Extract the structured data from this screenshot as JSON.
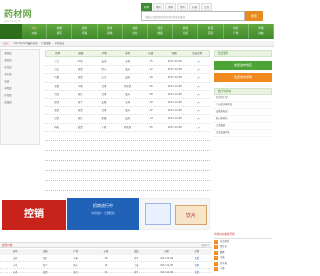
{
  "header": {
    "logo_text": "药材网",
    "logo_sub": "yaocai.com",
    "search_tabs": [
      "药材",
      "供应",
      "求购",
      "资讯",
      "价格",
      "企业"
    ],
    "search_placeholder": "请输入您要搜索的中药名称或关键词",
    "search_button": "搜索"
  },
  "nav": {
    "columns": [
      [
        "药材",
        "价格"
      ],
      [
        "供求",
        "资讯"
      ],
      [
        "商务",
        "行情"
      ],
      [
        "药市",
        "基地"
      ],
      [
        "交易",
        "企业"
      ],
      [
        "药企",
        "健康"
      ],
      [
        "药材",
        "分析"
      ],
      [
        "名词",
        "百科"
      ],
      [
        "中药",
        "产地"
      ],
      [
        "市场",
        "动态"
      ]
    ]
  },
  "subbar": {
    "items": [
      "公告：",
      "2017年12月最新价格",
      "行情通知",
      "市场直击"
    ]
  },
  "leftcol": {
    "items": [
      "· 根茎类",
      "· 果实类",
      "· 全草类",
      "· 花叶类",
      "· 皮类",
      "· 动物类",
      "· 矿物类",
      "· 菌藻类"
    ]
  },
  "table": {
    "headers": [
      "名称",
      "规格",
      "产地",
      "市场",
      "价格",
      "日期",
      "历史走势"
    ],
    "rows": [
      [
        "三七",
        "20头",
        "云南",
        "玉林",
        "75",
        "2017-12-08"
      ],
      [
        "白芷",
        "统货",
        "四川",
        "亳州",
        "12",
        "2017-12-08"
      ],
      [
        "丹参",
        "统货",
        "山东",
        "安国",
        "18",
        "2017-12-08"
      ],
      [
        "党参",
        "中条",
        "甘肃",
        "荷花池",
        "56",
        "2017-12-08"
      ],
      [
        "当归",
        "统片",
        "甘肃",
        "亳州",
        "68",
        "2017-12-08"
      ],
      [
        "茯苓",
        "统个",
        "安徽",
        "玉林",
        "20",
        "2017-12-08"
      ],
      [
        "黄芪",
        "统货",
        "甘肃",
        "亳州",
        "22",
        "2017-12-08"
      ],
      [
        "甘草",
        "统片",
        "新疆",
        "安国",
        "14",
        "2017-12-08"
      ],
      [
        "枸杞",
        "统货",
        "宁夏",
        "荷花池",
        "45",
        "2017-12-08"
      ]
    ]
  },
  "right_panel": {
    "head": "会员服务",
    "green_button": "免费发布供应",
    "orange_button": "免费发布求购",
    "list_head": "热门中药材",
    "list": [
      "北京同仁堂",
      "广州采芝林药业",
      "安徽协和成",
      "四川新荷花",
      "江西樟树",
      "河北安国药业"
    ]
  },
  "banners": {
    "red": "控销",
    "blue_title": "招商进行中",
    "blue_sub": "中药饮片 · 全国招商",
    "pack_text": "饮片"
  },
  "bottom": {
    "title": "最新价格",
    "more": "更多>>",
    "headers": [
      "名称",
      "规格",
      "产地",
      "价格",
      "涨跌",
      "日期",
      "详情"
    ],
    "rows": [
      [
        "山药",
        "统片",
        "河南",
        "28",
        "持平",
        "2017-12-08",
        "查看"
      ],
      [
        "川芎",
        "统个",
        "四川",
        "16",
        "上涨",
        "2017-12-08",
        "查看"
      ],
      [
        "白术",
        "统货",
        "浙江",
        "26",
        "持平",
        "2017-12-08",
        "查看"
      ]
    ]
  },
  "right_bottom": {
    "title": "中药材价格排行榜",
    "items": [
      "冬虫夏草",
      "西红花",
      "麝香",
      "牛黄",
      "羚羊角",
      "人参"
    ]
  }
}
